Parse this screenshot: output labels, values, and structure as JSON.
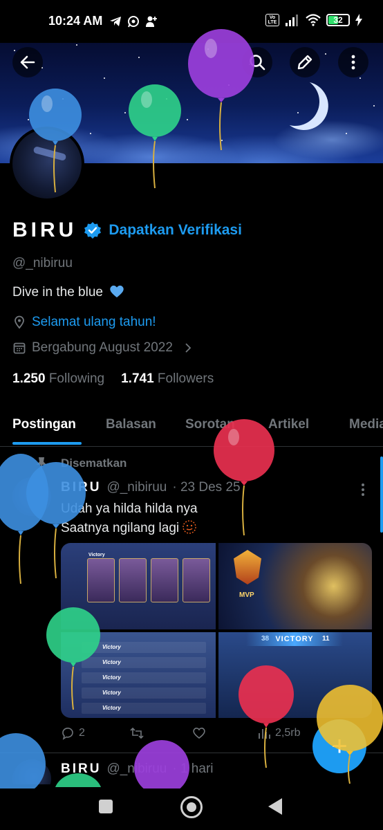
{
  "status_bar": {
    "time": "10:24 AM",
    "battery": "32",
    "icons": [
      "telegram-icon",
      "whatsapp-icon",
      "add-person-icon",
      "volte-icon",
      "signal-icon",
      "wifi-icon",
      "battery-icon",
      "charging-icon"
    ],
    "volte_label": "Vo LTE"
  },
  "header": {
    "icons": [
      "back-arrow-icon",
      "search-icon",
      "edit-icon",
      "more-vertical-icon"
    ]
  },
  "profile": {
    "name": "BIRU",
    "verify_cta": "Dapatkan Verifikasi",
    "handle": "@_nibiruu",
    "bio": "Dive in the blue",
    "bio_emoji": "blue-heart",
    "location": "Selamat ulang tahun!",
    "joined": "Bergabung August 2022",
    "following_count": "1.250",
    "following_label": "Following",
    "followers_count": "1.741",
    "followers_label": "Followers"
  },
  "tabs": [
    "Postingan",
    "Balasan",
    "Sorotan",
    "Artikel",
    "Media"
  ],
  "active_tab": "Postingan",
  "pinned_post": {
    "pinned_label": "Disematkan",
    "author": "BIRU",
    "handle": "@_nibiruu",
    "date": "· 23 Des 25",
    "text_line1": "Udah ya hilda hilda nya",
    "text_line2": "Saatnya ngilang lagi",
    "media_labels": {
      "victory": "Victory",
      "mvp": "MVP",
      "victory_banner": "VICTORY",
      "score_left": "38",
      "score_right": "11"
    },
    "replies": "2",
    "views": "2,5rb"
  },
  "second_post": {
    "author": "BIRU",
    "handle": "@_nibiruu",
    "date": "· 1 hari"
  },
  "fab_symbol": "+",
  "colors": {
    "accent": "#1d9bf0",
    "background": "#000000",
    "muted": "#71767b",
    "balloon_blue": "#3d8fe0",
    "balloon_green": "#2fd38a",
    "balloon_purple": "#9b3fdc",
    "balloon_red": "#e8304f",
    "balloon_yellow": "#f2c230"
  }
}
